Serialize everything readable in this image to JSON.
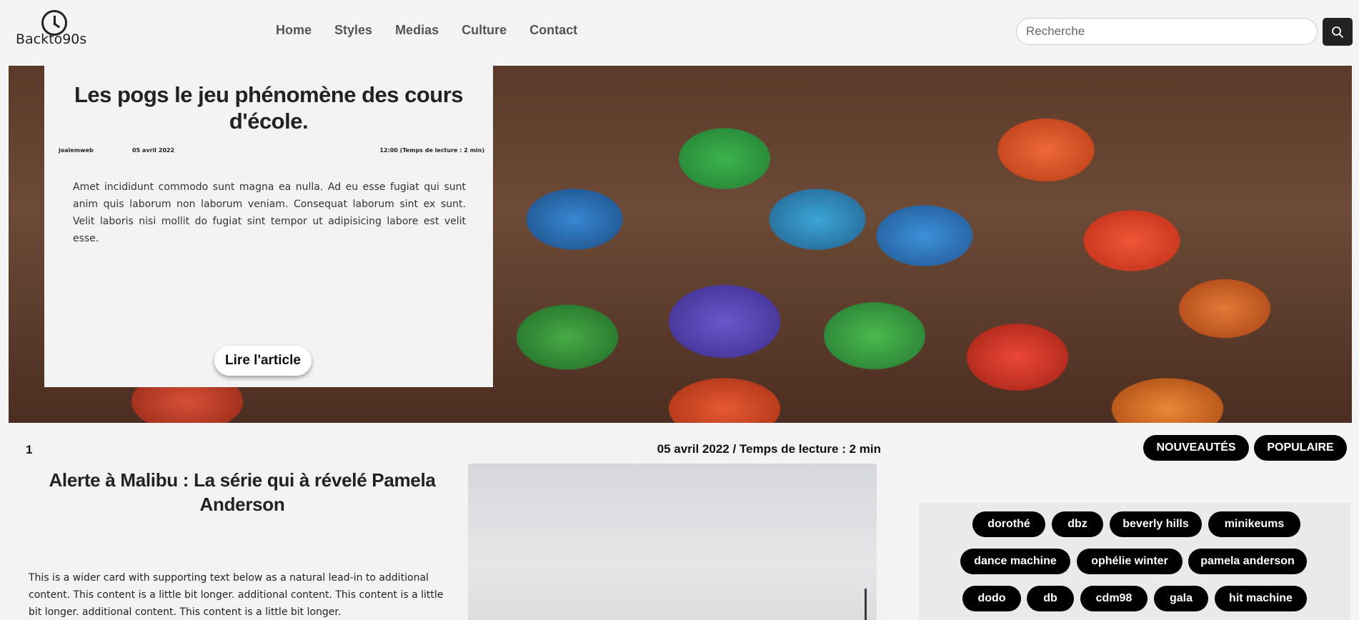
{
  "header": {
    "logo_text": "Backto90s",
    "nav": [
      "Home",
      "Styles",
      "Medias",
      "Culture",
      "Contact"
    ],
    "search_placeholder": "Recherche"
  },
  "hero": {
    "title": "Les pogs le jeu phénomène des cours d'école.",
    "author": "joalemweb",
    "date": "05 avril 2022",
    "time": "12:00 (Temps de lecture : 2 min)",
    "text": "Amet incididunt commodo sunt magna ea nulla. Ad eu esse fugiat qui sunt anim quis laborum non laborum veniam. Consequat laborum sint ex sunt. Velit laboris nisi mollit do fugiat sint tempor ut adipisicing labore est velit esse.",
    "button": "Lire l'article"
  },
  "article": {
    "number": "1",
    "date": "05 avril 2022 / Temps de lecture : 2 min",
    "title": "Alerte à Malibu : La série qui à révelé Pamela Anderson",
    "text": "This is a wider card with supporting text below as a natural lead-in to additional content. This content is a little bit longer. additional content. This content is a little bit longer. additional content. This content is a little bit longer."
  },
  "sidebar": {
    "sort_new": "NOUVEAUTÉS",
    "sort_popular": "POPULAIRE",
    "tags": [
      "dorothé",
      "dbz",
      "beverly hills",
      "minikeums",
      "dance machine",
      "ophélie winter",
      "pamela anderson",
      "dodo",
      "db",
      "cdm98",
      "gala",
      "hit machine"
    ]
  }
}
